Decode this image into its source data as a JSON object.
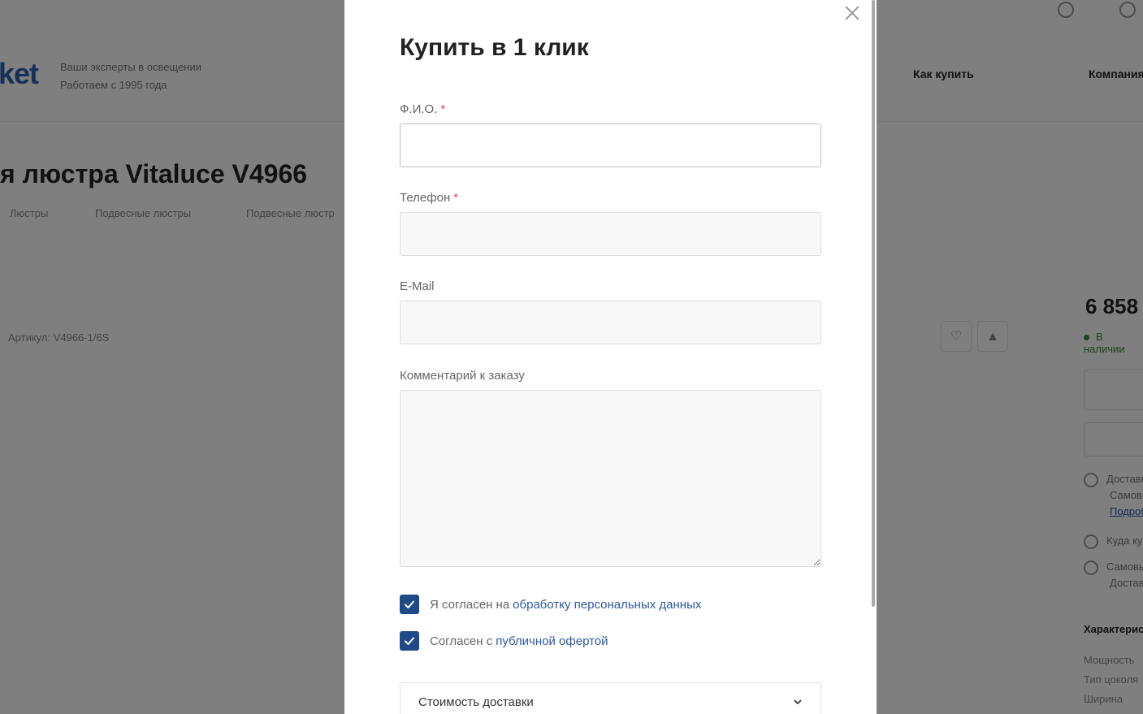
{
  "background": {
    "logo": "ket",
    "slogan_line1": "Ваши эксперты в освещении",
    "slogan_line2": "Работаем с 1995 года",
    "nav": [
      "Как купить",
      "Компания"
    ],
    "title": "я люстра Vitaluce V4966",
    "breadcrumbs": [
      "Люстры",
      "Подвесные люстры",
      "Подвесные люстр"
    ],
    "article": "Артикул: V4966-1/6S",
    "price": "6 858",
    "stock": "В наличии",
    "info": [
      "Доставка",
      "Самовывоз",
      "Подробнее",
      "Куда купить",
      "Самовывоз",
      "Доставка"
    ],
    "characteristics_title": "Характеристики",
    "characteristics": [
      "Мощность",
      "Тип цоколя",
      "Ширина"
    ]
  },
  "modal": {
    "title": "Купить в 1 клик",
    "close_icon": "close-icon",
    "required_mark": "*",
    "fields": {
      "name_label": "Ф.И.О.",
      "phone_label": "Телефон",
      "email_label": "E-Mail",
      "comment_label": "Комментарий к заказу"
    },
    "consent_personal": {
      "text": "Я согласен на",
      "link": "обработку персональных данных",
      "checked": true
    },
    "consent_offer": {
      "text": "Согласен с",
      "link": "публичной офертой",
      "checked": true
    },
    "delivery": {
      "label": "Стоимость доставки"
    },
    "colors": {
      "accent": "#1e4a8a",
      "link": "#2f5aa0",
      "required": "#e04a4a"
    }
  }
}
